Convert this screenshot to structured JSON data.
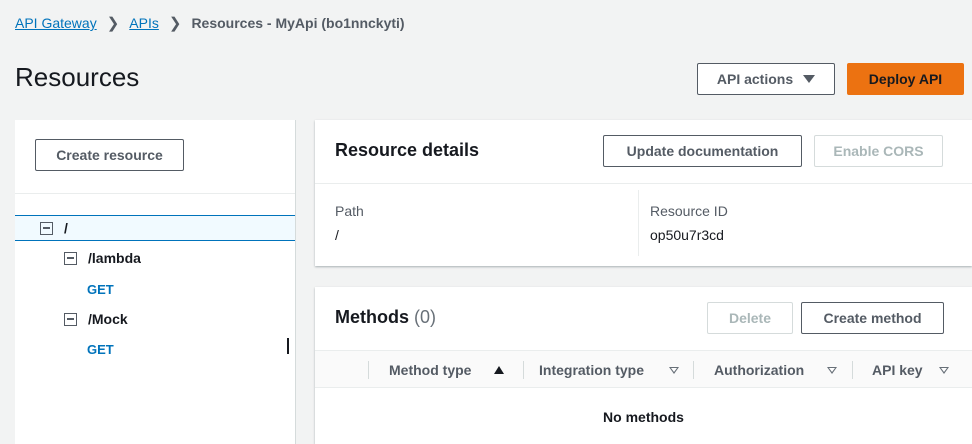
{
  "breadcrumb": {
    "items": [
      "API Gateway",
      "APIs"
    ],
    "current": "Resources - MyApi (bo1nnckyti)"
  },
  "page": {
    "title": "Resources"
  },
  "header_actions": {
    "api_actions_label": "API actions",
    "deploy_label": "Deploy API"
  },
  "colors": {
    "primary": "#ec7211",
    "link": "#0073bb",
    "selected_bg": "#f1faff"
  },
  "sidebar": {
    "create_resource_label": "Create resource",
    "tree": {
      "root": "/",
      "lambda": "/lambda",
      "lambda_get": "GET",
      "mock": "/Mock",
      "mock_get": "GET"
    }
  },
  "resource_details": {
    "title": "Resource details",
    "update_doc_label": "Update documentation",
    "enable_cors_label": "Enable CORS",
    "path_label": "Path",
    "path_value": "/",
    "resource_id_label": "Resource ID",
    "resource_id_value": "op50u7r3cd"
  },
  "methods": {
    "title": "Methods",
    "count": "(0)",
    "delete_label": "Delete",
    "create_label": "Create method",
    "columns": [
      "Method type",
      "Integration type",
      "Authorization",
      "API key"
    ],
    "empty_text": "No methods"
  }
}
